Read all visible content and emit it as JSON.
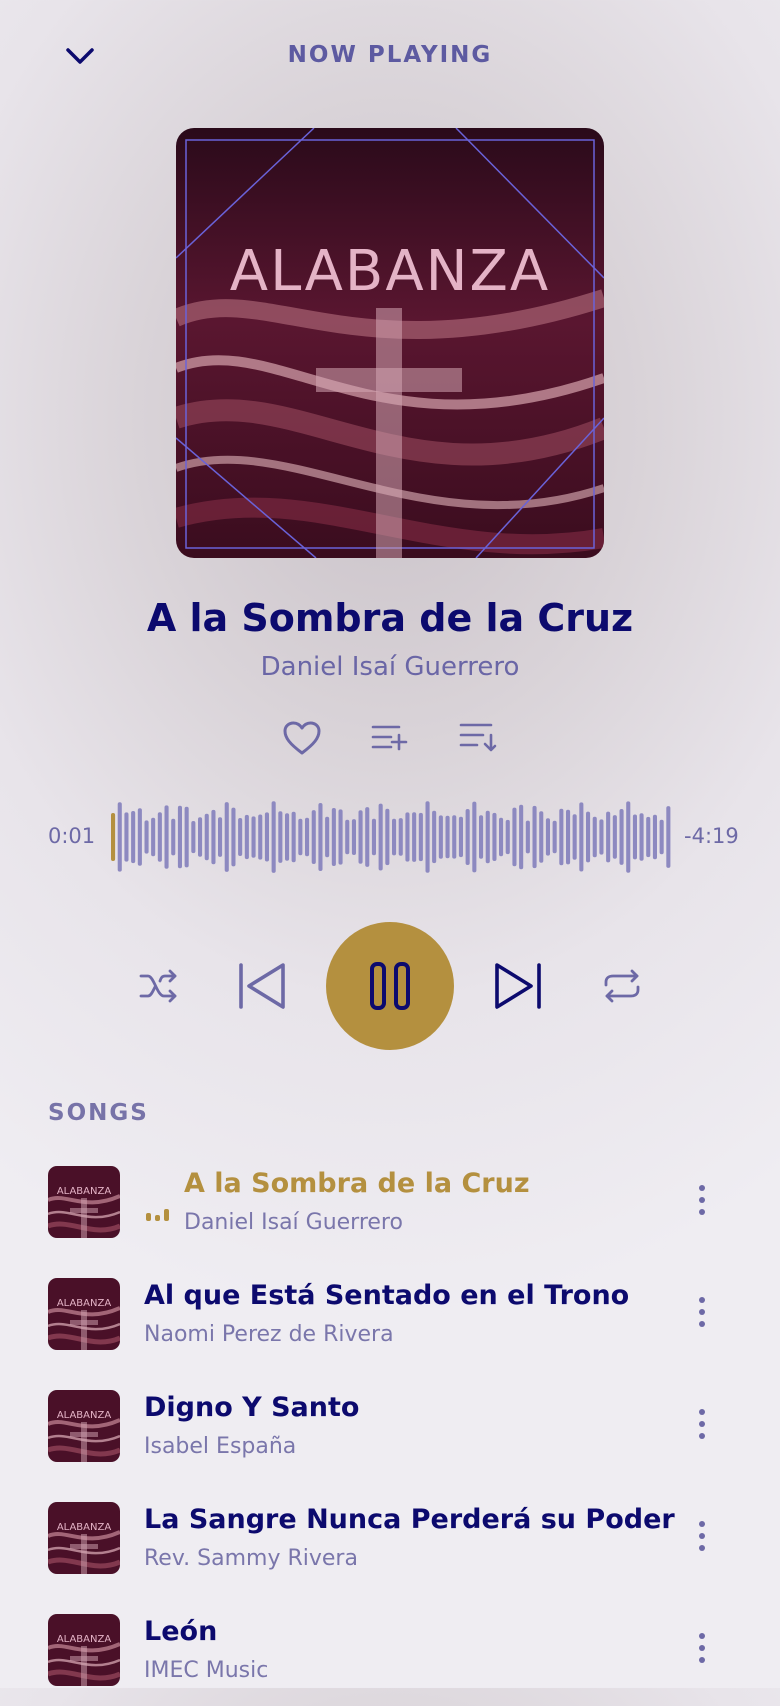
{
  "header": {
    "title": "NOW PLAYING",
    "collapse_icon": "chevron-down-icon"
  },
  "album_art": {
    "text": "ALABANZA"
  },
  "now_playing": {
    "title": "A la Sombra de la Cruz",
    "artist": "Daniel Isaí Guerrero"
  },
  "actions": [
    "heart-icon",
    "add-to-queue-icon",
    "playlist-icon"
  ],
  "progress": {
    "elapsed": "0:01",
    "remaining": "-4:19",
    "fraction": 0.004
  },
  "controls": [
    "shuffle-icon",
    "previous-icon",
    "pause-icon",
    "next-icon",
    "repeat-icon"
  ],
  "colors": {
    "accent": "#b4903f",
    "primary": "#0c0a6e",
    "secondary": "#6d69a6",
    "wave": "#8d89c0"
  },
  "songs_section": {
    "label": "SONGS"
  },
  "songs": [
    {
      "title": "A la Sombra de la Cruz",
      "artist": "Daniel Isaí Guerrero",
      "active": true
    },
    {
      "title": "Al que Está Sentado en el Trono",
      "artist": "Naomi Perez de Rivera",
      "active": false
    },
    {
      "title": "Digno Y Santo",
      "artist": "Isabel España",
      "active": false
    },
    {
      "title": "La Sangre Nunca Perderá su Poder",
      "artist": "Rev. Sammy Rivera",
      "active": false
    },
    {
      "title": "León",
      "artist": "IMEC Music",
      "active": false
    }
  ]
}
